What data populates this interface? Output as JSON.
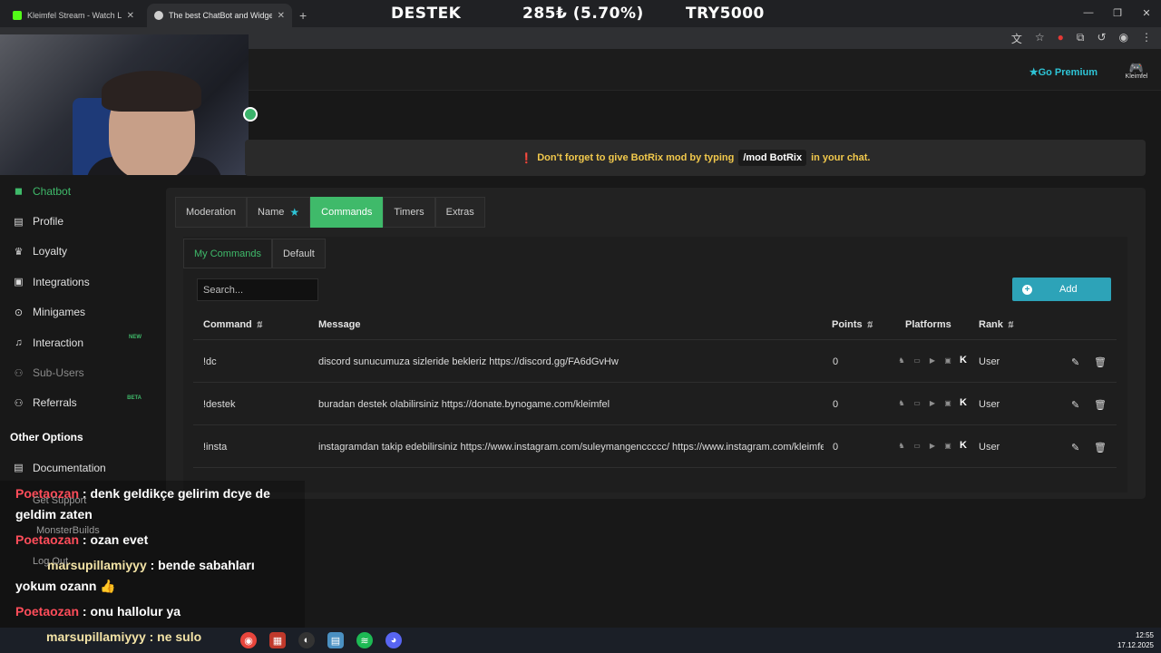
{
  "browser": {
    "tabs": [
      {
        "title": "Kleimfel Stream - Watch Live on",
        "icon_color": "#53fc18"
      },
      {
        "title": "The best ChatBot and Widgets",
        "icon_color": "#cfcfcf"
      }
    ],
    "new_tab": "+",
    "ticker": [
      "DESTEK",
      "285₺ (5.70%)",
      "TRY5000"
    ]
  },
  "header": {
    "premium": "Go Premium",
    "username": "Kleimfel"
  },
  "banner": {
    "before": "Don't forget to give BotRix mod by typing",
    "code": "/mod BotRix",
    "after": "in your chat."
  },
  "sidebar": {
    "items": [
      {
        "label": "Chatbot",
        "icon": "robot-icon",
        "glyph": "🤖"
      },
      {
        "label": "Profile",
        "icon": "id-card-icon",
        "glyph": "▤"
      },
      {
        "label": "Loyalty",
        "icon": "trophy-icon",
        "glyph": "🏆"
      },
      {
        "label": "Integrations",
        "icon": "plug-icon",
        "glyph": "▣"
      },
      {
        "label": "Minigames",
        "icon": "gamepad-icon",
        "glyph": "🎮"
      },
      {
        "label": "Interaction",
        "icon": "music-icon",
        "glyph": "♫",
        "badge": "NEW"
      },
      {
        "label": "Sub-Users",
        "icon": "users-icon",
        "glyph": "👥"
      },
      {
        "label": "Referrals",
        "icon": "referrals-icon",
        "glyph": "👥",
        "badge": "BETA"
      }
    ],
    "other_heading": "Other Options",
    "other_items": [
      {
        "label": "Documentation",
        "icon": "book-icon",
        "glyph": "▤"
      }
    ]
  },
  "tabs": [
    "Moderation",
    "Name",
    "Commands",
    "Timers",
    "Extras"
  ],
  "subtabs": [
    "My Commands",
    "Default"
  ],
  "search": {
    "placeholder": "Search..."
  },
  "add_button": "Add",
  "table": {
    "headers": {
      "command": "Command",
      "message": "Message",
      "points": "Points",
      "platforms": "Platforms",
      "rank": "Rank"
    },
    "rows": [
      {
        "command": "!dc",
        "message": "discord sunucumuza sizleride bekleriz https://discord.gg/FA6dGvHw",
        "points": "0",
        "rank": "User"
      },
      {
        "command": "!destek",
        "message": "buradan destek olabilirsiniz https://donate.bynogame.com/kleimfel",
        "points": "0",
        "rank": "User"
      },
      {
        "command": "!insta",
        "message": "instagramdan takip edebilirsiniz https://www.instagram.com/suleymangenccccc/ https://www.instagram.com/kleimfel_",
        "points": "0",
        "rank": "User"
      }
    ]
  },
  "chat": [
    {
      "user": "Poetaozan",
      "text": " : denk geldikçe gelirim dcye de"
    },
    {
      "user": "",
      "text": "geldim zaten"
    },
    {
      "user": "Poetaozan",
      "text": " : ozan evet"
    },
    {
      "user": "marsupillamiyyy",
      "text": " : bende sabahları"
    },
    {
      "user": "",
      "text": "yokum ozann 👍"
    },
    {
      "user": "Poetaozan",
      "text": " : onu hallolur ya"
    }
  ],
  "chat_ghost": [
    "Get Support",
    "MonsterBuilds",
    "Log Out"
  ],
  "taskbar": {
    "chatline": "marsupillamiyyy : ne sulo",
    "time": "12:55",
    "date": "17.12.2025"
  }
}
